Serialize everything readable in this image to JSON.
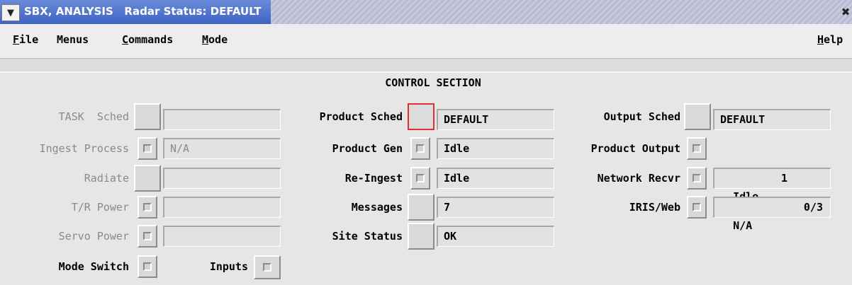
{
  "window": {
    "title": "SBX, ANALYSIS   Radar Status: DEFAULT",
    "menu_icon": "chevron-down-icon",
    "close_icon": "close-icon"
  },
  "menubar": {
    "file": "File",
    "menus": "Menus",
    "commands": "Commands",
    "mode": "Mode",
    "help": "Help"
  },
  "control": {
    "title": "CONTROL SECTION",
    "left": {
      "task_sched": "TASK  Sched",
      "ingest_process": "Ingest Process",
      "ingest_process_value": "N/A",
      "radiate": "Radiate",
      "tr_power": "T/R Power",
      "servo_power": "Servo Power",
      "mode_switch": "Mode Switch",
      "inputs": "Inputs"
    },
    "middle": {
      "product_sched": "Product Sched",
      "product_sched_value": "DEFAULT",
      "product_gen": "Product Gen",
      "product_gen_value": "Idle",
      "re_ingest": "Re-Ingest",
      "re_ingest_value": "Idle",
      "messages": "Messages",
      "messages_value": "7",
      "site_status": "Site Status",
      "site_status_value": "OK"
    },
    "right": {
      "output_sched": "Output Sched",
      "output_sched_value": "DEFAULT",
      "product_output": "Product Output",
      "network_recvr": "Network Recvr",
      "network_recvr_value": "Idle",
      "network_recvr_count": "1",
      "iris_web": "IRIS/Web",
      "iris_web_value": "N/A",
      "iris_web_count": "0/3"
    }
  },
  "colors": {
    "title_blue": "#3d63c4",
    "focus_red": "#e03030",
    "disabled_text": "#8a8a8a"
  }
}
